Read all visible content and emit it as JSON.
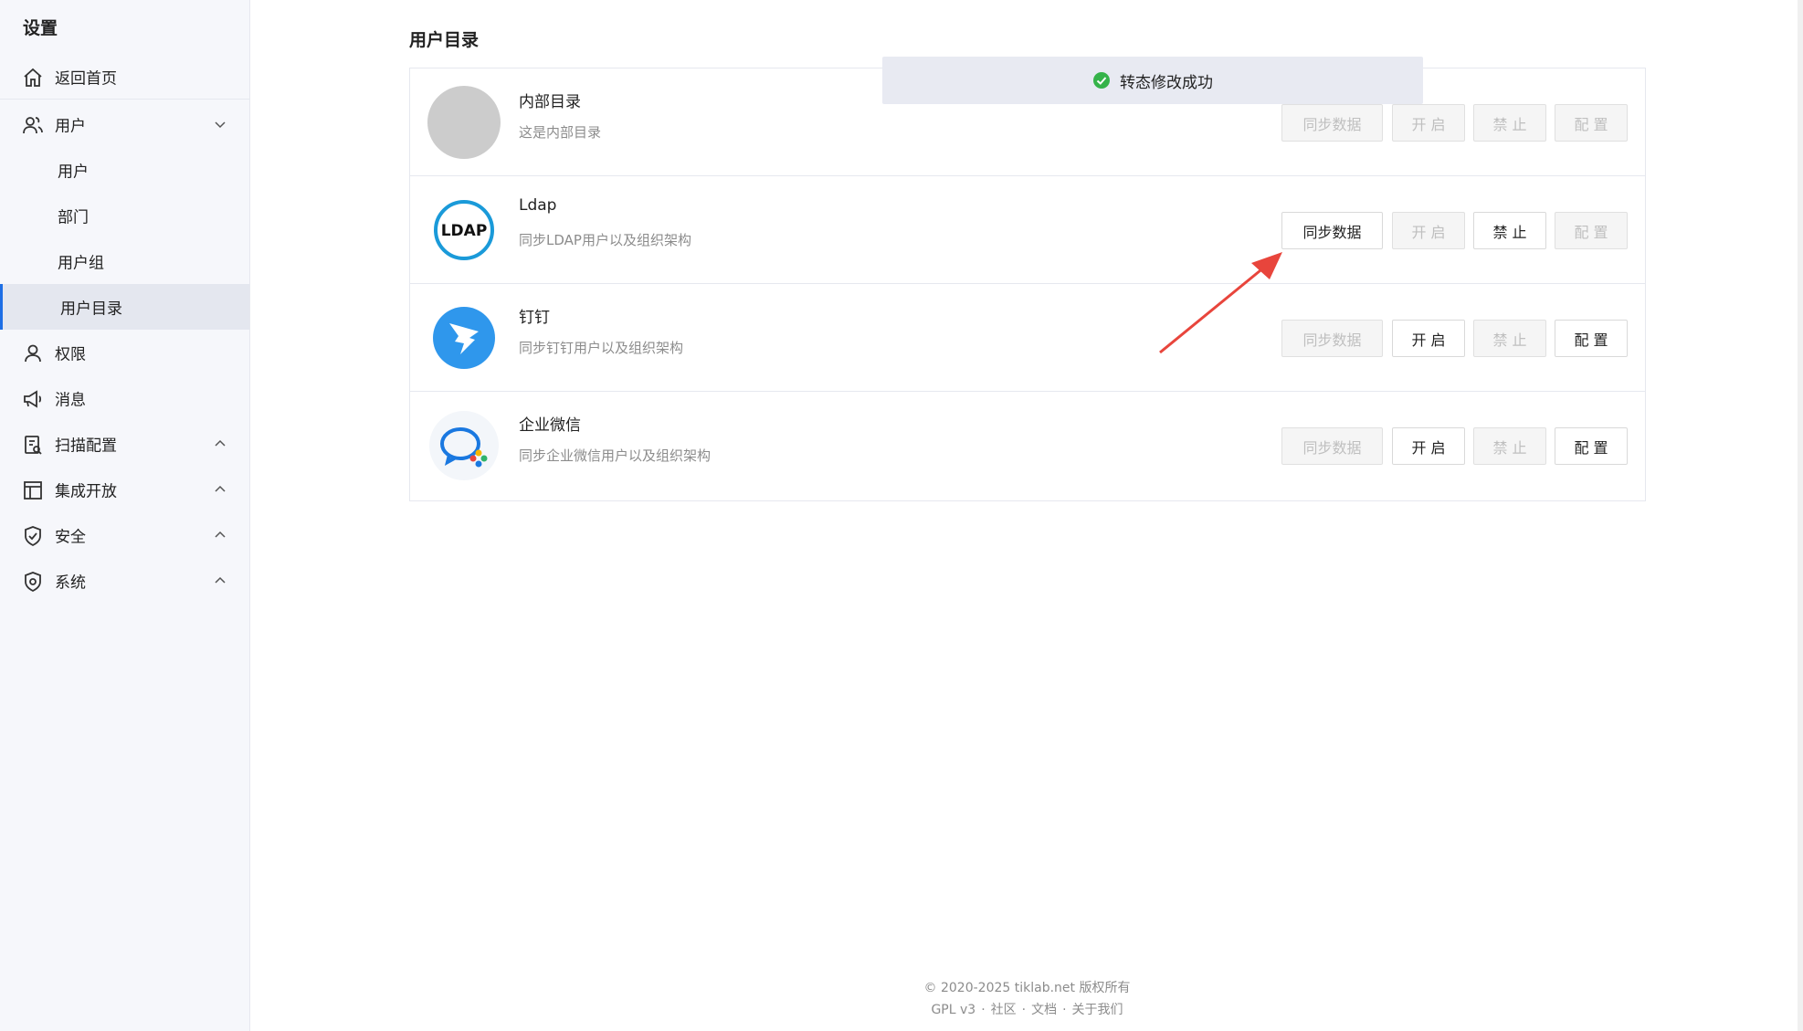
{
  "sidebar": {
    "title": "设置",
    "home": "返回首页",
    "user_group": "用户",
    "sub": [
      "用户",
      "部门",
      "用户组",
      "用户目录"
    ],
    "permission": "权限",
    "message": "消息",
    "scan_config": "扫描配置",
    "integration": "集成开放",
    "security": "安全",
    "system": "系统"
  },
  "main": {
    "title": "用户目录",
    "toast": "转态修改成功",
    "directories": [
      {
        "name": "内部目录",
        "desc": "这是内部目录",
        "logo": "gray-circle",
        "sync": "同步数据",
        "open": "开 启",
        "ban": "禁 止",
        "config": "配 置",
        "sync_enabled": false,
        "open_enabled": false,
        "ban_enabled": false,
        "config_enabled": false
      },
      {
        "name": "Ldap",
        "desc": "同步LDAP用户以及组织架构",
        "logo": "LDAP",
        "sync": "同步数据",
        "open": "开 启",
        "ban": "禁 止",
        "config": "配 置",
        "sync_enabled": true,
        "open_enabled": false,
        "ban_enabled": true,
        "config_enabled": false
      },
      {
        "name": "钉钉",
        "desc": "同步钉钉用户以及组织架构",
        "logo": "dingtalk-icon",
        "sync": "同步数据",
        "open": "开 启",
        "ban": "禁 止",
        "config": "配 置",
        "sync_enabled": false,
        "open_enabled": true,
        "ban_enabled": false,
        "config_enabled": true
      },
      {
        "name": "企业微信",
        "desc": "同步企业微信用户以及组织架构",
        "logo": "wecom-icon",
        "sync": "同步数据",
        "open": "开 启",
        "ban": "禁 止",
        "config": "配 置",
        "sync_enabled": false,
        "open_enabled": true,
        "ban_enabled": false,
        "config_enabled": true
      }
    ]
  },
  "footer": {
    "copyright": "© 2020-2025 tiklab.net 版权所有",
    "links": [
      "GPL v3",
      "社区",
      "文档",
      "关于我们"
    ]
  },
  "colors": {
    "accent": "#1e6fe5",
    "annotation_arrow": "#e8453c"
  }
}
